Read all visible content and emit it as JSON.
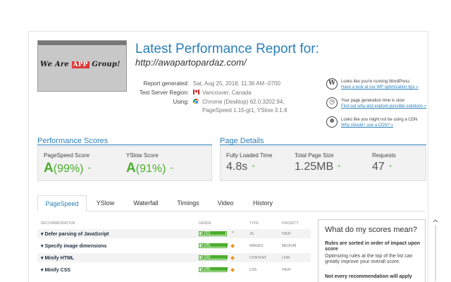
{
  "report": {
    "title": "Latest Performance Report for:",
    "url": "http://awapartopardaz.com/",
    "screenshot_text": {
      "pre": "We Are ",
      "app": "APP",
      "post": " Group!"
    },
    "meta": {
      "generated_label": "Report generated:",
      "generated_value": "Sat, Aug 25, 2018, 11:36 AM -0700",
      "region_label": "Test Server Region:",
      "region_value": "Vancouver, Canada",
      "using_label": "Using:",
      "using_value_1": "Chrome (Desktop) 62.0.3202.94,",
      "using_value_2": "PageSpeed 1.15-gt1, YSlow 3.1.8"
    }
  },
  "tips": [
    {
      "icon": "wordpress-icon",
      "glyph": "W",
      "text": "Looks like you're running WordPress",
      "link": "Have a look at our WP optimization tips »"
    },
    {
      "icon": "stopwatch-icon",
      "glyph": "◷",
      "text": "Your page generation time is slow",
      "link": "Find out why and explore possible solutions »"
    },
    {
      "icon": "globe-icon",
      "glyph": "⊕",
      "text": "Looks like you might not be using a CDN",
      "link": "Why should I use a CDN? »"
    }
  ],
  "scores": {
    "heading": "Performance Scores",
    "pagespeed": {
      "label": "PageSpeed Score",
      "grade": "A",
      "value": "(99%)"
    },
    "yslow": {
      "label": "YSlow Score",
      "grade": "A",
      "value": "(91%)"
    }
  },
  "details": {
    "heading": "Page Details",
    "load": {
      "label": "Fully Loaded Time",
      "value": "4.8s"
    },
    "size": {
      "label": "Total Page Size",
      "value": "1.25MB"
    },
    "requests": {
      "label": "Requests",
      "value": "47"
    }
  },
  "tabs": [
    "PageSpeed",
    "YSlow",
    "Waterfall",
    "Timings",
    "Video",
    "History"
  ],
  "table": {
    "headers": {
      "rec": "Recommendation",
      "grade": "Grade",
      "type": "Type",
      "priority": "Priority"
    },
    "rows": [
      {
        "name": "Defer parsing of JavaScript",
        "grade": "A (92)",
        "score": 92,
        "type": "JS",
        "priority": "HIGH",
        "trend": "up"
      },
      {
        "name": "Specify image dimensions",
        "grade": "A (99)",
        "score": 99,
        "type": "IMAGES",
        "priority": "MEDIUM",
        "trend": "same"
      },
      {
        "name": "Minify HTML",
        "grade": "A (99)",
        "score": 99,
        "type": "CONTENT",
        "priority": "LOW",
        "trend": "same"
      },
      {
        "name": "Minify CSS",
        "grade": "A (99)",
        "score": 99,
        "type": "CSS",
        "priority": "HIGH",
        "trend": "same"
      }
    ]
  },
  "sidebar": {
    "heading": "What do my scores mean?",
    "bold_text": "Rules are sorted in order of impact upon score",
    "text": "Optimizing rules at the top of the list can greatly improve your overall score.",
    "bold_text_2": "Not every recommendation will apply"
  },
  "colors": {
    "accent": "#2a7fb8",
    "good": "#4bae2e",
    "neutral": "#e89a2e"
  }
}
